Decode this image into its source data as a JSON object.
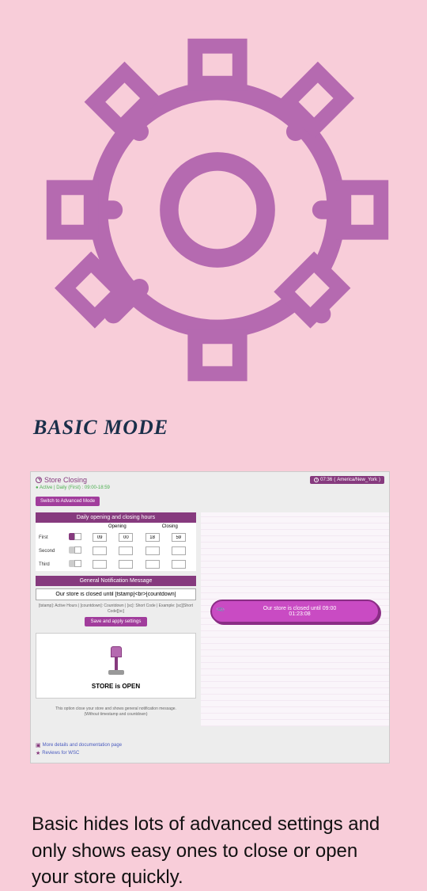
{
  "main_title": "BASIC MODE",
  "panel": {
    "title": "Store Closing",
    "status": "Active | Daily (First) : 09:00-18:59",
    "tz_time": "07:36",
    "tz_name": "America/New_York",
    "advanced_btn": "Switch to Advanced Mode"
  },
  "hours": {
    "header": "Daily opening and closing hours",
    "col_open": "Opening",
    "col_close": "Closing",
    "rows": [
      {
        "label": "First",
        "on": true,
        "open_h": "09",
        "open_m": "00",
        "close_h": "18",
        "close_m": "59"
      },
      {
        "label": "Second",
        "on": false,
        "open_h": "",
        "open_m": "",
        "close_h": "",
        "close_m": ""
      },
      {
        "label": "Third",
        "on": false,
        "open_h": "",
        "open_m": "",
        "close_h": "",
        "close_m": ""
      }
    ]
  },
  "msg": {
    "header": "General Notification Message",
    "value": "Our store is closed until [tstamp]<br>[countdown]",
    "placeholders": "[tstamp]: Active Hours | [countdown]: Countdown | [sc]: Short Code | Example: [sc][Short Code][sc]",
    "save_btn": "Save and apply settings"
  },
  "store": {
    "status": "STORE is OPEN",
    "note1": "This option close your store and shows general notification message.",
    "note2": "(Without timestamp and countdown)"
  },
  "notif": {
    "line1": "Our store is closed until 09:00",
    "line2": "01:23:08"
  },
  "footer": {
    "docs": "More details and documentation page",
    "reviews": "Reviews for WSC"
  },
  "description": "Basic hides lots of advanced settings and only shows easy ones to close or open your store quickly."
}
